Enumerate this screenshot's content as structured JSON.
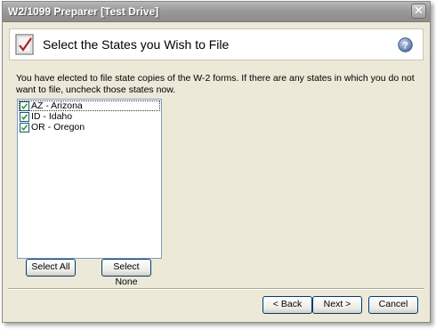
{
  "window": {
    "title": "W2/1099 Preparer [Test Drive]",
    "close_icon": "close-icon"
  },
  "header": {
    "title": "Select the States you Wish to File",
    "icon": "checklist-icon",
    "help_icon": "help-icon"
  },
  "description": "You have elected to file state copies of the W-2 forms. If there are any states in which you do not want to file,  uncheck those states now.",
  "states": [
    {
      "label": "AZ - Arizona",
      "checked": true
    },
    {
      "label": "ID - Idaho",
      "checked": true
    },
    {
      "label": "OR - Oregon",
      "checked": true
    }
  ],
  "buttons": {
    "select_all": "Select All",
    "select_none": "Select None",
    "back": "< Back",
    "next": "Next >",
    "cancel": "Cancel"
  },
  "colors": {
    "titlebar": "#9a9a9a",
    "dialog_bg": "#ece9d8",
    "button_border": "#003c74"
  }
}
